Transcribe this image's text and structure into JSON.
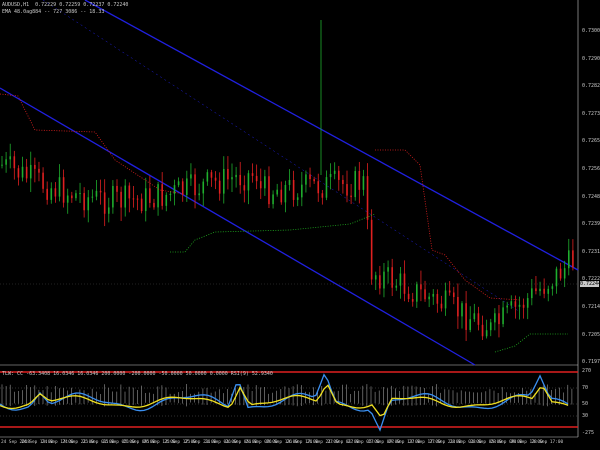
{
  "main_chart": {
    "symbol_line": "AUDUSD,H1  0.72229 0.72259 0.72237 0.72240",
    "indicator_line": "EMA 48.0ag884 -- 727 3086 -- 18.33",
    "current_price": "0.72244",
    "price_labels": [
      "0.73005",
      "0.72905",
      "0.72825",
      "0.72735",
      "0.72650",
      "0.72565",
      "0.72480",
      "0.72395",
      "0.72310",
      "0.72225",
      "0.72140",
      "0.72055",
      "0.71975"
    ],
    "colors": {
      "bull": "#1fae2d",
      "bear": "#e02020",
      "channel": "#2020e0",
      "trail_up": "#e02020",
      "trail_dn": "#20b020"
    }
  },
  "sub_chart": {
    "header": "TLW: CC -63.3408 16.0346 16.0346 200.0000 -200.0000 -50.0000 50.0000 0.0000 RSI(9) 52.9340",
    "level_labels": [
      "270",
      "70",
      "50",
      "30",
      "-275"
    ],
    "colors": {
      "fast": "#3a8ff0",
      "slow": "#f0e020",
      "bands": "#e02020"
    }
  },
  "time_axis": [
    "24 Sep 2018",
    "24 Sep 13:00",
    "24 Sep 17:00",
    "24 Sep 21:00",
    "25 Sep 01:00",
    "25 Sep 05:00",
    "25 Sep 09:00",
    "25 Sep 13:00",
    "25 Sep 17:00",
    "25 Sep 21:00",
    "26 Sep 01:00",
    "26 Sep 05:00",
    "26 Sep 09:00",
    "26 Sep 13:00",
    "26 Sep 17:00",
    "26 Sep 21:00",
    "27 Sep 01:00",
    "27 Sep 05:00",
    "27 Sep 09:00",
    "27 Sep 13:00",
    "27 Sep 17:00",
    "27 Sep 21:00",
    "28 Sep 01:00",
    "28 Sep 05:00",
    "28 Sep 09:00",
    "28 Sep 13:00",
    "28 Sep 17:00"
  ]
}
